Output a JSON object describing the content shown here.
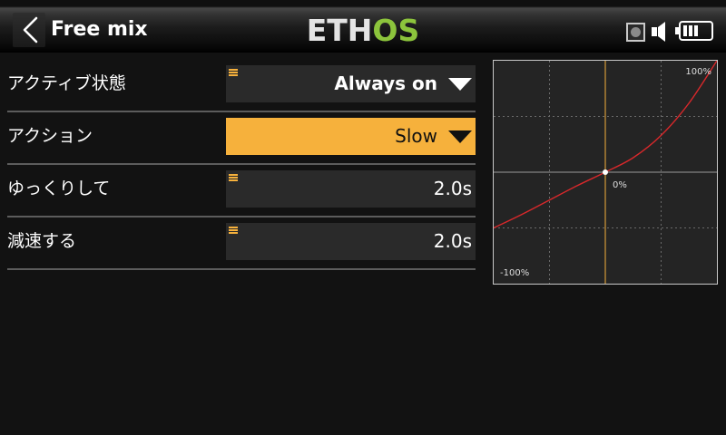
{
  "header": {
    "title": "Free mix",
    "logo": {
      "left": "ETH",
      "right": "OS"
    },
    "battery": {
      "bars": 3
    }
  },
  "icons": {
    "back": "chevron-left-icon",
    "status": "record-icon",
    "volume": "speaker-icon",
    "battery": "battery-icon",
    "field_options": "options-icon",
    "dropdown": "dropdown-arrow-icon"
  },
  "colors": {
    "background": "#121212",
    "field": "#2a2a2a",
    "accent": "#f6b13c",
    "logo_green": "#8cc43c",
    "curve": "#d8282b"
  },
  "fields": [
    {
      "label": "アクティブ状態",
      "value": "Always on",
      "focused": false
    },
    {
      "label": "アクション",
      "value": "Slow",
      "focused": true
    },
    {
      "label": "ゆっくりして",
      "value": "2.0s",
      "focused": false
    },
    {
      "label": "減速する",
      "value": "2.0s",
      "focused": false
    }
  ],
  "chart_data": {
    "type": "line",
    "x": [
      -100,
      -75,
      -50,
      -25,
      0,
      25,
      50,
      75,
      100
    ],
    "series": [
      {
        "values": [
          -50,
          -38,
          -25,
          -12,
          0,
          13,
          33,
          62,
          100
        ],
        "color": "#d8282b"
      }
    ],
    "xlim": [
      -100,
      100
    ],
    "ylim": [
      -100,
      100
    ],
    "grid": true,
    "marker_point": [
      0,
      0
    ],
    "labels": {
      "max_label": "100%",
      "center_label": "0%",
      "min_label": "-100%"
    }
  }
}
